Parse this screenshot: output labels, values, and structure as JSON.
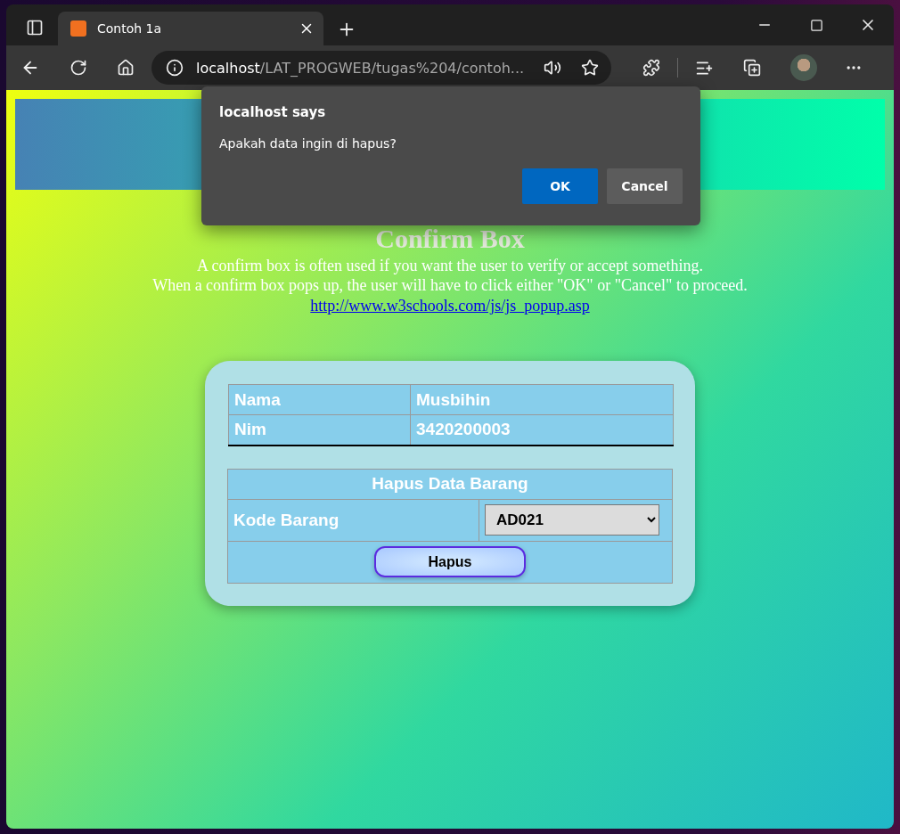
{
  "browser": {
    "tabs": [
      {
        "title": "Contoh 1a",
        "selected": true
      }
    ],
    "address": {
      "host": "localhost",
      "path": "/LAT_PROGWEB/tugas%204/contoh..."
    }
  },
  "dialog": {
    "title": "localhost says",
    "message": "Apakah data ingin di hapus?",
    "buttons": [
      {
        "label": "OK",
        "kind": "primary"
      },
      {
        "label": "Cancel",
        "kind": "secondary"
      }
    ]
  },
  "page": {
    "heading": "Confirm Box",
    "description": [
      "A confirm box is often used if you want the user to verify or accept something.",
      "When a confirm box pops up, the user will have to click either \"OK\" or \"Cancel\" to proceed."
    ],
    "link": "http://www.w3schools.com/js/js_popup.asp",
    "identity": [
      {
        "label": "Nama",
        "value": "Musbihin"
      },
      {
        "label": "Nim",
        "value": "3420200003"
      }
    ],
    "form": {
      "title": "Hapus Data Barang",
      "field_label": "Kode Barang",
      "select_value": "AD021",
      "button": "Hapus"
    }
  }
}
